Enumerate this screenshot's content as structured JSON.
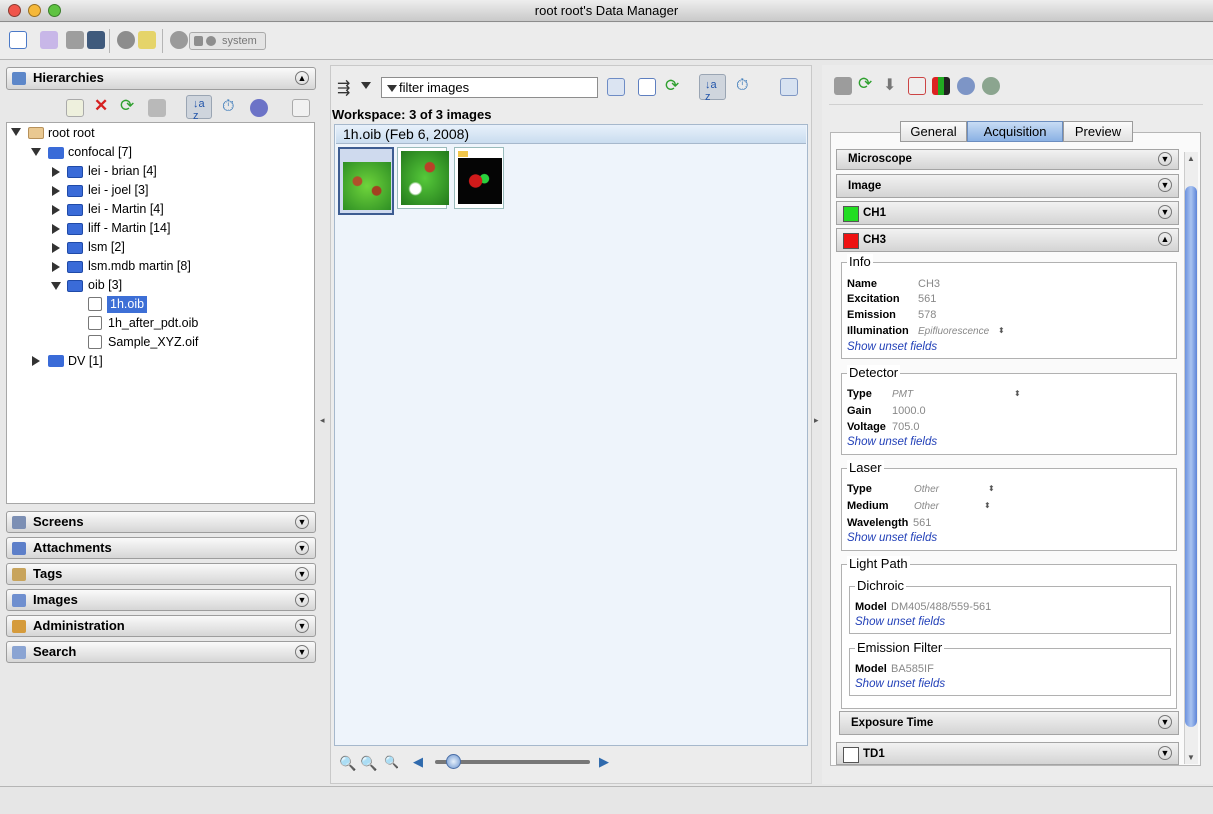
{
  "window": {
    "title": "root root's Data Manager"
  },
  "toolbar": {
    "system_label": "system"
  },
  "left": {
    "hierarchies_title": "Hierarchies",
    "tree": {
      "root": "root root",
      "confocal": "confocal [7]",
      "children": [
        "lei - brian [4]",
        "lei - joel [3]",
        "lei - Martin [4]",
        "liff - Martin [14]",
        "lsm [2]",
        "lsm.mdb martin [8]",
        "oib [3]"
      ],
      "oib_items": [
        "1h.oib",
        "1h_after_pdt.oib",
        "Sample_XYZ.oif"
      ],
      "dv": "DV [1]"
    },
    "panels": [
      "Screens",
      "Attachments",
      "Tags",
      "Images",
      "Administration",
      "Search"
    ]
  },
  "center": {
    "filter_text": "filter  images",
    "workspace_label": "Workspace: 3 of 3 images",
    "group_title": "1h.oib (Feb 6, 2008)"
  },
  "right": {
    "tabs": [
      "General",
      "Acquisition",
      "Preview"
    ],
    "accordion": {
      "microscope": "Microscope",
      "image": "Image",
      "ch1": "CH1",
      "ch3": "CH3",
      "exposure": "Exposure Time",
      "td1": "TD1"
    },
    "show_unset": "Show unset fields",
    "info": {
      "legend": "Info",
      "rows": [
        {
          "label": "Name",
          "value": "CH3"
        },
        {
          "label": "Excitation",
          "value": "561"
        },
        {
          "label": "Emission",
          "value": "578"
        },
        {
          "label": "Illumination",
          "value": "Epifluorescence"
        }
      ]
    },
    "detector": {
      "legend": "Detector",
      "rows": [
        {
          "label": "Type",
          "value": "PMT"
        },
        {
          "label": "Gain",
          "value": "1000.0"
        },
        {
          "label": "Voltage",
          "value": "705.0"
        }
      ]
    },
    "laser": {
      "legend": "Laser",
      "rows": [
        {
          "label": "Type",
          "value": "Other"
        },
        {
          "label": "Medium",
          "value": "Other"
        },
        {
          "label": "Wavelength",
          "value": "561"
        }
      ]
    },
    "lightpath": {
      "legend": "Light Path",
      "dichroic": {
        "legend": "Dichroic",
        "label": "Model",
        "value": "DM405/488/559-561"
      },
      "emission": {
        "legend": "Emission Filter",
        "label": "Model",
        "value": "BA585IF"
      }
    }
  },
  "colors": {
    "ch1": "#22dd22",
    "ch3": "#ee1111",
    "td1": "#ffffff",
    "selection": "#3d6fd6"
  }
}
